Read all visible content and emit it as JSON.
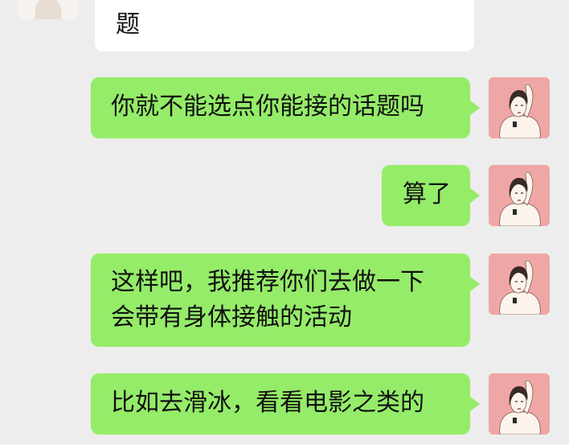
{
  "messages": [
    {
      "side": "left",
      "text": "题"
    },
    {
      "side": "right",
      "text": "你就不能选点你能接的话题吗"
    },
    {
      "side": "right",
      "text": "算了"
    },
    {
      "side": "right",
      "lines": [
        "这样吧，我推荐你们去做一下",
        "会带有身体接触的活动"
      ]
    },
    {
      "side": "right",
      "text": "比如去滑冰，看看电影之类的"
    }
  ],
  "colors": {
    "background": "#ededed",
    "sent_bubble": "#95ec69",
    "received_bubble": "#ffffff",
    "sent_avatar_bg": "#efa7a5"
  },
  "icons": {
    "received_avatar": "woman-portrait-avatar",
    "sent_avatar": "woman-portrait-avatar"
  }
}
